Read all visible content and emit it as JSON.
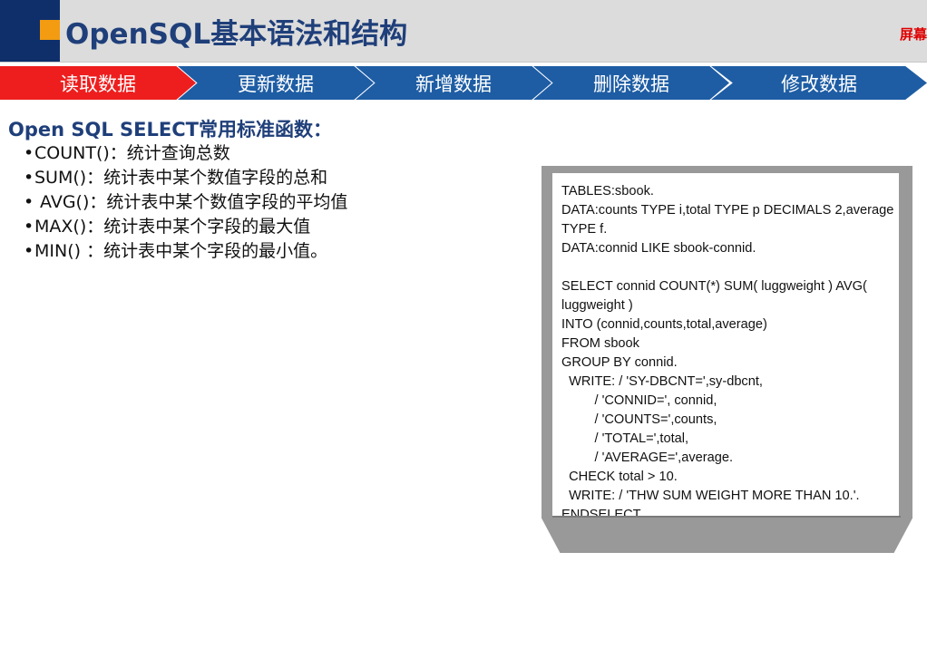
{
  "header": {
    "title": "OpenSQL基本语法和结构",
    "corner_note": "屏幕"
  },
  "tabs": [
    {
      "label": "读取数据",
      "active": true
    },
    {
      "label": "更新数据",
      "active": false
    },
    {
      "label": "新增数据",
      "active": false
    },
    {
      "label": "删除数据",
      "active": false
    },
    {
      "label": "修改数据",
      "active": false
    }
  ],
  "section": {
    "title": "Open SQL SELECT常用标准函数：",
    "bullet_char": "•",
    "items": [
      "COUNT()：统计查询总数",
      "SUM()：统计表中某个数值字段的总和",
      " AVG()：统计表中某个数值字段的平均值",
      "MAX()：统计表中某个字段的最大值",
      "MIN() ：统计表中某个字段的最小值。"
    ]
  },
  "code_lines": [
    "TABLES:sbook.",
    "DATA:counts TYPE i,total TYPE p DECIMALS 2,average",
    "TYPE f.",
    "DATA:connid LIKE sbook-connid.",
    "",
    "SELECT connid COUNT(*) SUM( luggweight ) AVG(",
    "luggweight )",
    "INTO (connid,counts,total,average)",
    "FROM sbook",
    "GROUP BY connid.",
    "  WRITE: / 'SY-DBCNT=',sy-dbcnt,",
    "         / 'CONNID=', connid,",
    "         / 'COUNTS=',counts,",
    "         / 'TOTAL=',total,",
    "         / 'AVERAGE=',average.",
    "  CHECK total > 10.",
    "  WRITE: / 'THW SUM WEIGHT MORE THAN 10.'.",
    "ENDSELECT."
  ],
  "colors": {
    "navy": "#0f2f6b",
    "orange": "#f39c12",
    "tab_blue": "#1e5da4",
    "tab_active_red": "#ee1e1e",
    "title_blue": "#1f3f7a"
  }
}
